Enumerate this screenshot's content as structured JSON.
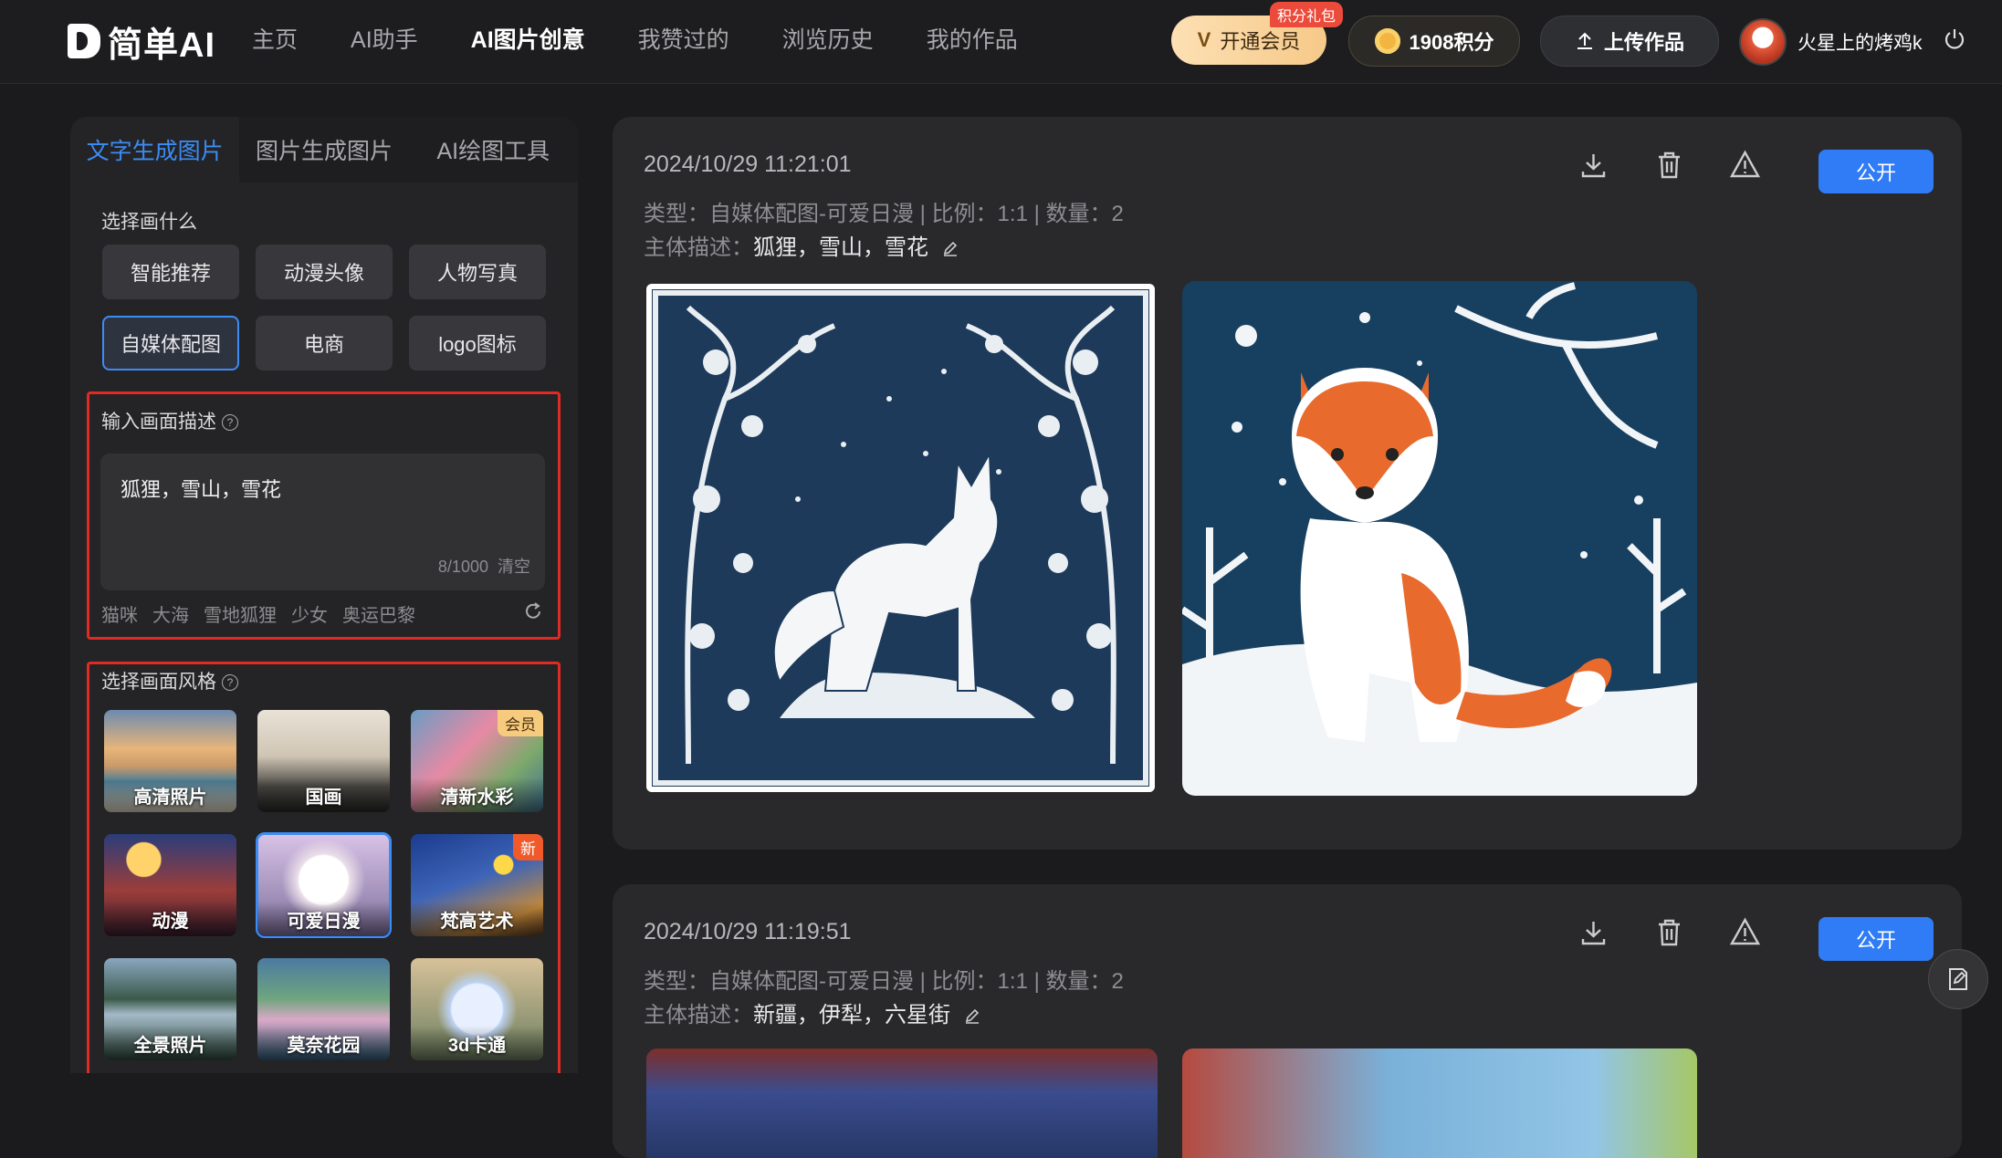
{
  "app": {
    "logo_text": "简单AI",
    "nav": [
      {
        "label": "主页"
      },
      {
        "label": "AI助手"
      },
      {
        "label": "AI图片创意"
      },
      {
        "label": "我赞过的"
      },
      {
        "label": "浏览历史"
      },
      {
        "label": "我的作品"
      }
    ],
    "active_nav": "AI图片创意",
    "vip_label": "开通会员",
    "vip_tag": "积分礼包",
    "points_label": "1908积分",
    "upload_label": "上传作品",
    "username": "火星上的烤鸡k"
  },
  "left_panel": {
    "tabs": [
      {
        "label": "文字生成图片"
      },
      {
        "label": "图片生成图片"
      },
      {
        "label": "AI绘图工具"
      }
    ],
    "choose_title": "选择画什么",
    "categories": [
      {
        "label": "智能推荐"
      },
      {
        "label": "动漫头像"
      },
      {
        "label": "人物写真"
      },
      {
        "label": "自媒体配图"
      },
      {
        "label": "电商"
      },
      {
        "label": "logo图标"
      }
    ],
    "active_category": "自媒体配图",
    "prompt_title": "输入画面描述",
    "prompt_value": "狐狸，雪山，雪花",
    "counter": "8/1000",
    "clear_label": "清空",
    "suggestions": [
      "猫咪",
      "大海",
      "雪地狐狸",
      "少女",
      "奥运巴黎"
    ],
    "style_title": "选择画面风格",
    "styles": [
      {
        "label": "高清照片",
        "badge": ""
      },
      {
        "label": "国画",
        "badge": ""
      },
      {
        "label": "清新水彩",
        "badge": "会员"
      },
      {
        "label": "动漫",
        "badge": ""
      },
      {
        "label": "可爱日漫",
        "badge": ""
      },
      {
        "label": "梵高艺术",
        "badge": "新"
      },
      {
        "label": "全景照片",
        "badge": ""
      },
      {
        "label": "莫奈花园",
        "badge": ""
      },
      {
        "label": "3d卡通",
        "badge": ""
      }
    ],
    "active_style": "可爱日漫"
  },
  "results": [
    {
      "date": "2024/10/29 11:21:01",
      "type_line": "类型：自媒体配图-可爱日漫 | 比例：1:1 | 数量：2",
      "subject_label": "主体描述：",
      "subject_value": "狐狸，雪山，雪花",
      "public_label": "公开"
    },
    {
      "date": "2024/10/29 11:19:51",
      "type_line": "类型：自媒体配图-可爱日漫 | 比例：1:1 | 数量：2",
      "subject_label": "主体描述：",
      "subject_value": "新疆，伊犁，六星街",
      "public_label": "公开"
    }
  ],
  "colors": {
    "accent": "#2f7cf6",
    "highlight_box": "#e12a22",
    "background": "#1b1b1d",
    "panel": "#242426"
  }
}
